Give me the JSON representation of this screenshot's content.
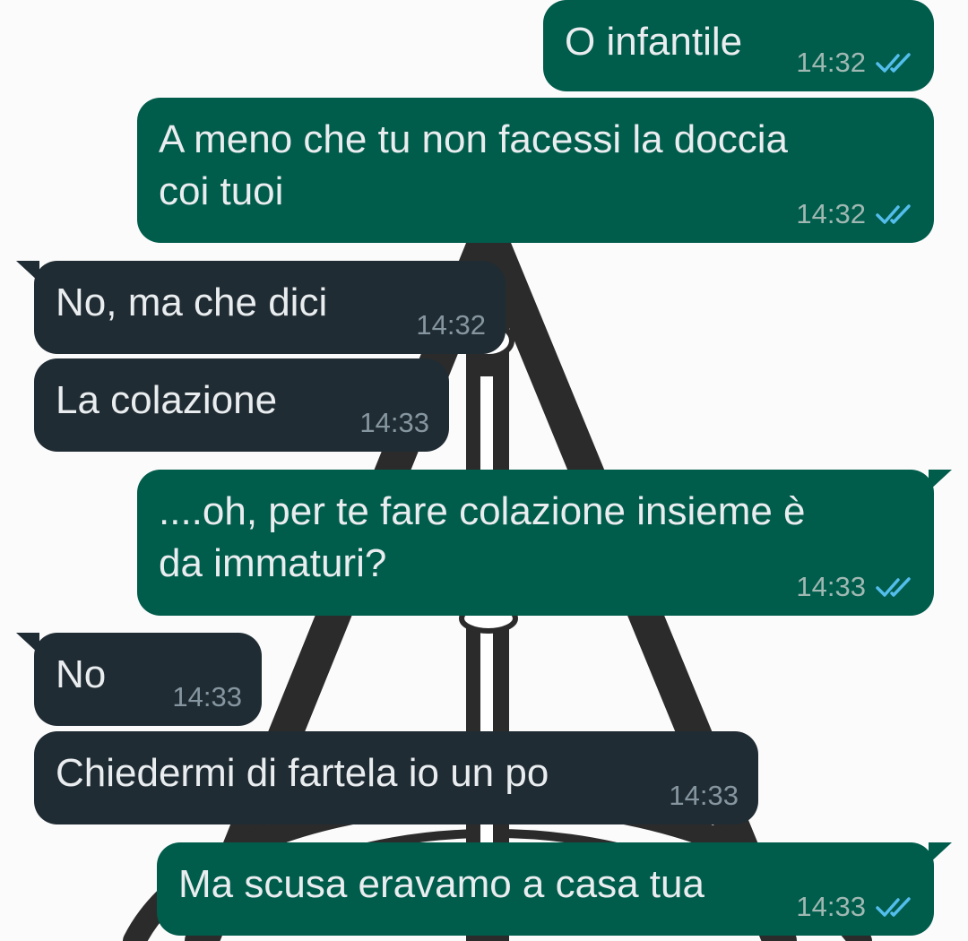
{
  "colors": {
    "outgoing_bubble": "#005c4b",
    "incoming_bubble": "#202c33",
    "message_text": "#e9edef",
    "read_ticks": "#53bdeb",
    "wallpaper_art": "#2b2b2b"
  },
  "wallpaper": {
    "motif": "deathly-hallows-symbol"
  },
  "messages": [
    {
      "direction": "outgoing",
      "text": "O infantile",
      "time": "14:32",
      "status_icon": "double-check-read-icon"
    },
    {
      "direction": "outgoing",
      "text_line1": "A meno che tu non facessi la doccia",
      "text_line2": "coi tuoi",
      "time": "14:32",
      "status_icon": "double-check-read-icon"
    },
    {
      "direction": "incoming",
      "text": "No, ma che dici",
      "time": "14:32"
    },
    {
      "direction": "incoming",
      "text": "La colazione",
      "time": "14:33"
    },
    {
      "direction": "outgoing",
      "text_line1": "....oh, per te fare colazione insieme è",
      "text_line2": "da immaturi?",
      "time": "14:33",
      "status_icon": "double-check-read-icon"
    },
    {
      "direction": "incoming",
      "text": "No",
      "time": "14:33"
    },
    {
      "direction": "incoming",
      "text": "Chiedermi di fartela io un po",
      "time": "14:33"
    },
    {
      "direction": "outgoing",
      "text": "Ma scusa eravamo a casa tua",
      "time": "14:33",
      "status_icon": "double-check-read-icon"
    }
  ]
}
